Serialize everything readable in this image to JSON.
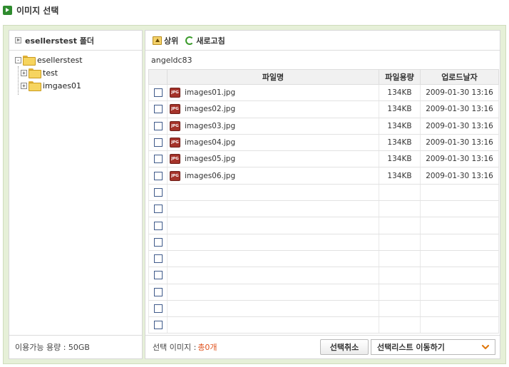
{
  "page": {
    "title": "이미지 선택"
  },
  "left_panel": {
    "header": "esellerstest 폴더",
    "tree": {
      "root": {
        "expander": "-",
        "label": "esellerstest"
      },
      "children": [
        {
          "expander": "+",
          "label": "test"
        },
        {
          "expander": "+",
          "label": "imgaes01"
        }
      ]
    },
    "footer": "이용가능 용량 : 50GB"
  },
  "toolbar": {
    "up_label": "상위",
    "refresh_label": "새로고침"
  },
  "path": "angeldc83",
  "table": {
    "headers": {
      "name": "파일명",
      "size": "파일용량",
      "date": "업로드날자"
    },
    "rows": [
      {
        "name": "images01.jpg",
        "size": "134KB",
        "date": "2009-01-30 13:16"
      },
      {
        "name": "images02.jpg",
        "size": "134KB",
        "date": "2009-01-30 13:16"
      },
      {
        "name": "images03.jpg",
        "size": "134KB",
        "date": "2009-01-30 13:16"
      },
      {
        "name": "images04.jpg",
        "size": "134KB",
        "date": "2009-01-30 13:16"
      },
      {
        "name": "images05.jpg",
        "size": "134KB",
        "date": "2009-01-30 13:16"
      },
      {
        "name": "images06.jpg",
        "size": "134KB",
        "date": "2009-01-30 13:16"
      },
      {
        "name": "",
        "size": "",
        "date": ""
      },
      {
        "name": "",
        "size": "",
        "date": ""
      },
      {
        "name": "",
        "size": "",
        "date": ""
      },
      {
        "name": "",
        "size": "",
        "date": ""
      },
      {
        "name": "",
        "size": "",
        "date": ""
      },
      {
        "name": "",
        "size": "",
        "date": ""
      },
      {
        "name": "",
        "size": "",
        "date": ""
      },
      {
        "name": "",
        "size": "",
        "date": ""
      },
      {
        "name": "",
        "size": "",
        "date": ""
      }
    ],
    "file_icon_text": "JPG"
  },
  "footer": {
    "selected_label": "선택 이미지 :",
    "selected_count": "총0개",
    "cancel_button": "선택취소",
    "dropdown_value": "선택리스트 이동하기"
  },
  "colors": {
    "accent": "#2e8b2e",
    "frame_bg": "#e6f0d8",
    "count_color": "#e0531e",
    "dropdown_arrow": "#e07a10"
  },
  "icons": [
    "title-arrow-icon",
    "panel-arrow-icon",
    "folder-icon",
    "up-folder-icon",
    "refresh-icon",
    "jpg-file-icon",
    "chevron-down-icon"
  ]
}
